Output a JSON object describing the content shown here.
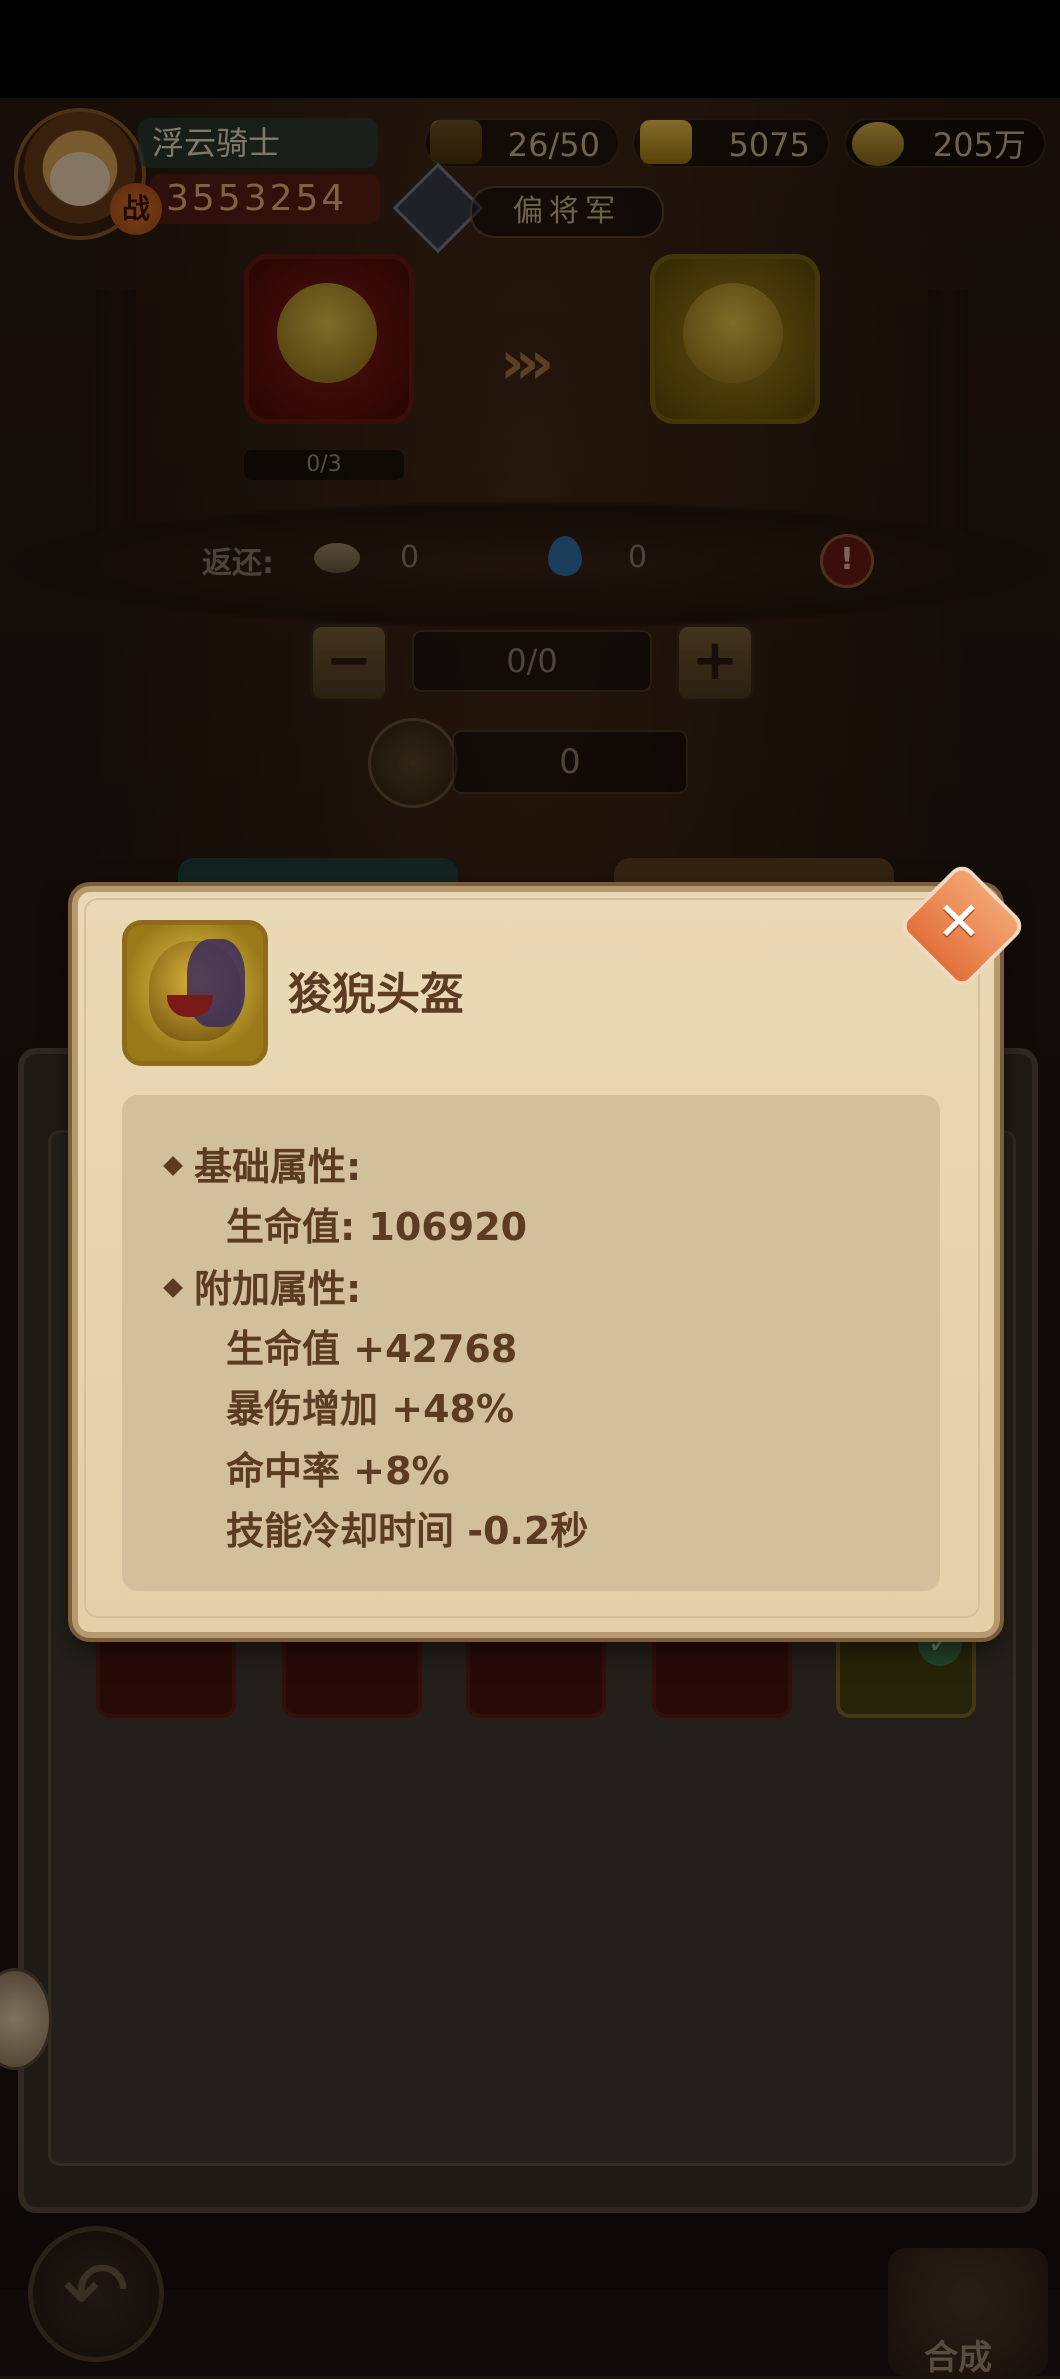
{
  "player": {
    "name": "浮云骑士",
    "power_badge": "战",
    "power": "3553254",
    "rank": "偏将军"
  },
  "resources": [
    {
      "icon": "stamina-icon",
      "value": "26/50"
    },
    {
      "icon": "gold-ingot-icon",
      "value": "5075"
    },
    {
      "icon": "coins-icon",
      "value": "205万"
    }
  ],
  "forge": {
    "source_progress": "0/3",
    "return_label": "返还:",
    "return_coins": "0",
    "return_essence": "0",
    "alert_symbol": "!",
    "minus_symbol": "−",
    "plus_symbol": "+",
    "count": "0/0",
    "cost": "0"
  },
  "popup": {
    "item_name": "狻猊头盔",
    "close_symbol": "✕",
    "base_header": "基础属性:",
    "base_stats": [
      "生命值: 106920"
    ],
    "extra_header": "附加属性:",
    "extra_stats": [
      "生命值 +42768",
      "暴伤增加 +48%",
      "命中率 +8%",
      "技能冷却时间 -0.2秒"
    ]
  },
  "bottom": {
    "back_symbol": "↶",
    "forge_label": "合成"
  },
  "colors": {
    "popup_bg": "#e3cfa8",
    "stats_bg": "#d2bf9b",
    "text_brown": "#5b3b22",
    "close_orange": "#e2703a"
  }
}
